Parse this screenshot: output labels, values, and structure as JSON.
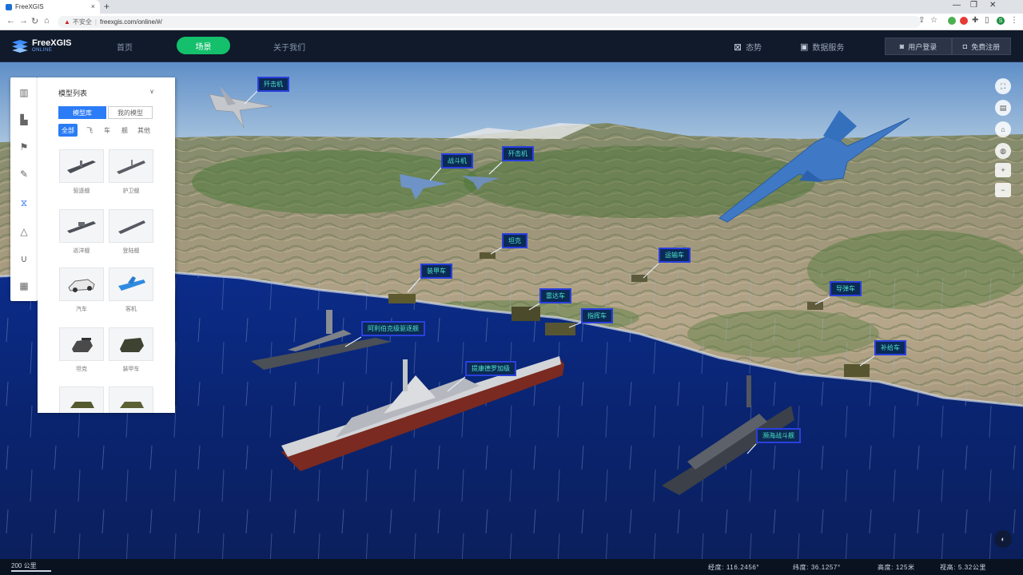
{
  "browser": {
    "tab_title": "FreeXGIS",
    "new_tab_glyph": "+",
    "close_glyph": "×",
    "insecure_label": "不安全",
    "url": "freexgis.com/online/#/",
    "profile_initial": "S"
  },
  "app": {
    "logo": {
      "name": "FreeXGIS",
      "sub": "ONLINE"
    },
    "nav": [
      {
        "label": "首页"
      },
      {
        "label": "场景"
      },
      {
        "label": "关于我们"
      }
    ],
    "tools": [
      {
        "label": "态势",
        "icon": "frame-icon"
      },
      {
        "label": "数据服务",
        "icon": "screen-icon"
      }
    ],
    "buttons": [
      {
        "label": "用户登录"
      },
      {
        "label": "免费注册"
      }
    ]
  },
  "panel": {
    "title": "模型列表",
    "caret": "∨",
    "segments": [
      {
        "label": "模型库",
        "active": true
      },
      {
        "label": "我的模型",
        "active": false
      }
    ],
    "filters": [
      {
        "label": "全部",
        "active": true
      },
      {
        "label": "飞",
        "active": false
      },
      {
        "label": "车",
        "active": false
      },
      {
        "label": "舰",
        "active": false
      },
      {
        "label": "其他",
        "active": false
      }
    ],
    "items": [
      {
        "caption": "驱逐舰",
        "kind": "ship"
      },
      {
        "caption": "护卫舰",
        "kind": "ship"
      },
      {
        "caption": "巡洋舰",
        "kind": "ship"
      },
      {
        "caption": "登陆舰",
        "kind": "ship2"
      },
      {
        "caption": "汽车",
        "kind": "car"
      },
      {
        "caption": "客机",
        "kind": "plane"
      },
      {
        "caption": "坦克",
        "kind": "tank"
      },
      {
        "caption": "装甲车",
        "kind": "truck"
      },
      {
        "caption": "",
        "kind": "truck"
      },
      {
        "caption": "",
        "kind": "truck"
      }
    ]
  },
  "labels": [
    {
      "name": "label-fighter-1",
      "text": "歼击机"
    },
    {
      "name": "label-fighter-2",
      "text": "战斗机"
    },
    {
      "name": "label-fighter-3",
      "text": "歼击机"
    },
    {
      "name": "label-vehicle-1",
      "text": "装甲车"
    },
    {
      "name": "label-vehicle-2",
      "text": "坦克"
    },
    {
      "name": "label-vehicle-3",
      "text": "雷达车"
    },
    {
      "name": "label-vehicle-4",
      "text": "指挥车"
    },
    {
      "name": "label-vehicle-5",
      "text": "运输车"
    },
    {
      "name": "label-vehicle-6",
      "text": "导弹车"
    },
    {
      "name": "label-vehicle-7",
      "text": "补给车"
    },
    {
      "name": "label-ship-1",
      "text": "阿利伯克级驱逐舰"
    },
    {
      "name": "label-ship-2",
      "text": "提康德罗加级"
    },
    {
      "name": "label-ship-3",
      "text": "濒海战斗舰"
    }
  ],
  "status": {
    "scale": "200 公里",
    "items": [
      {
        "text": "经度: 116.2456°"
      },
      {
        "text": "纬度: 36.1257°"
      },
      {
        "text": "高度: 125米"
      },
      {
        "text": "视高: 5.32公里"
      }
    ]
  },
  "colors": {
    "accent_green": "#14c06b",
    "accent_blue": "#2b7cf6",
    "label_border": "#2a3fe0",
    "label_text": "#4fe3c8"
  }
}
